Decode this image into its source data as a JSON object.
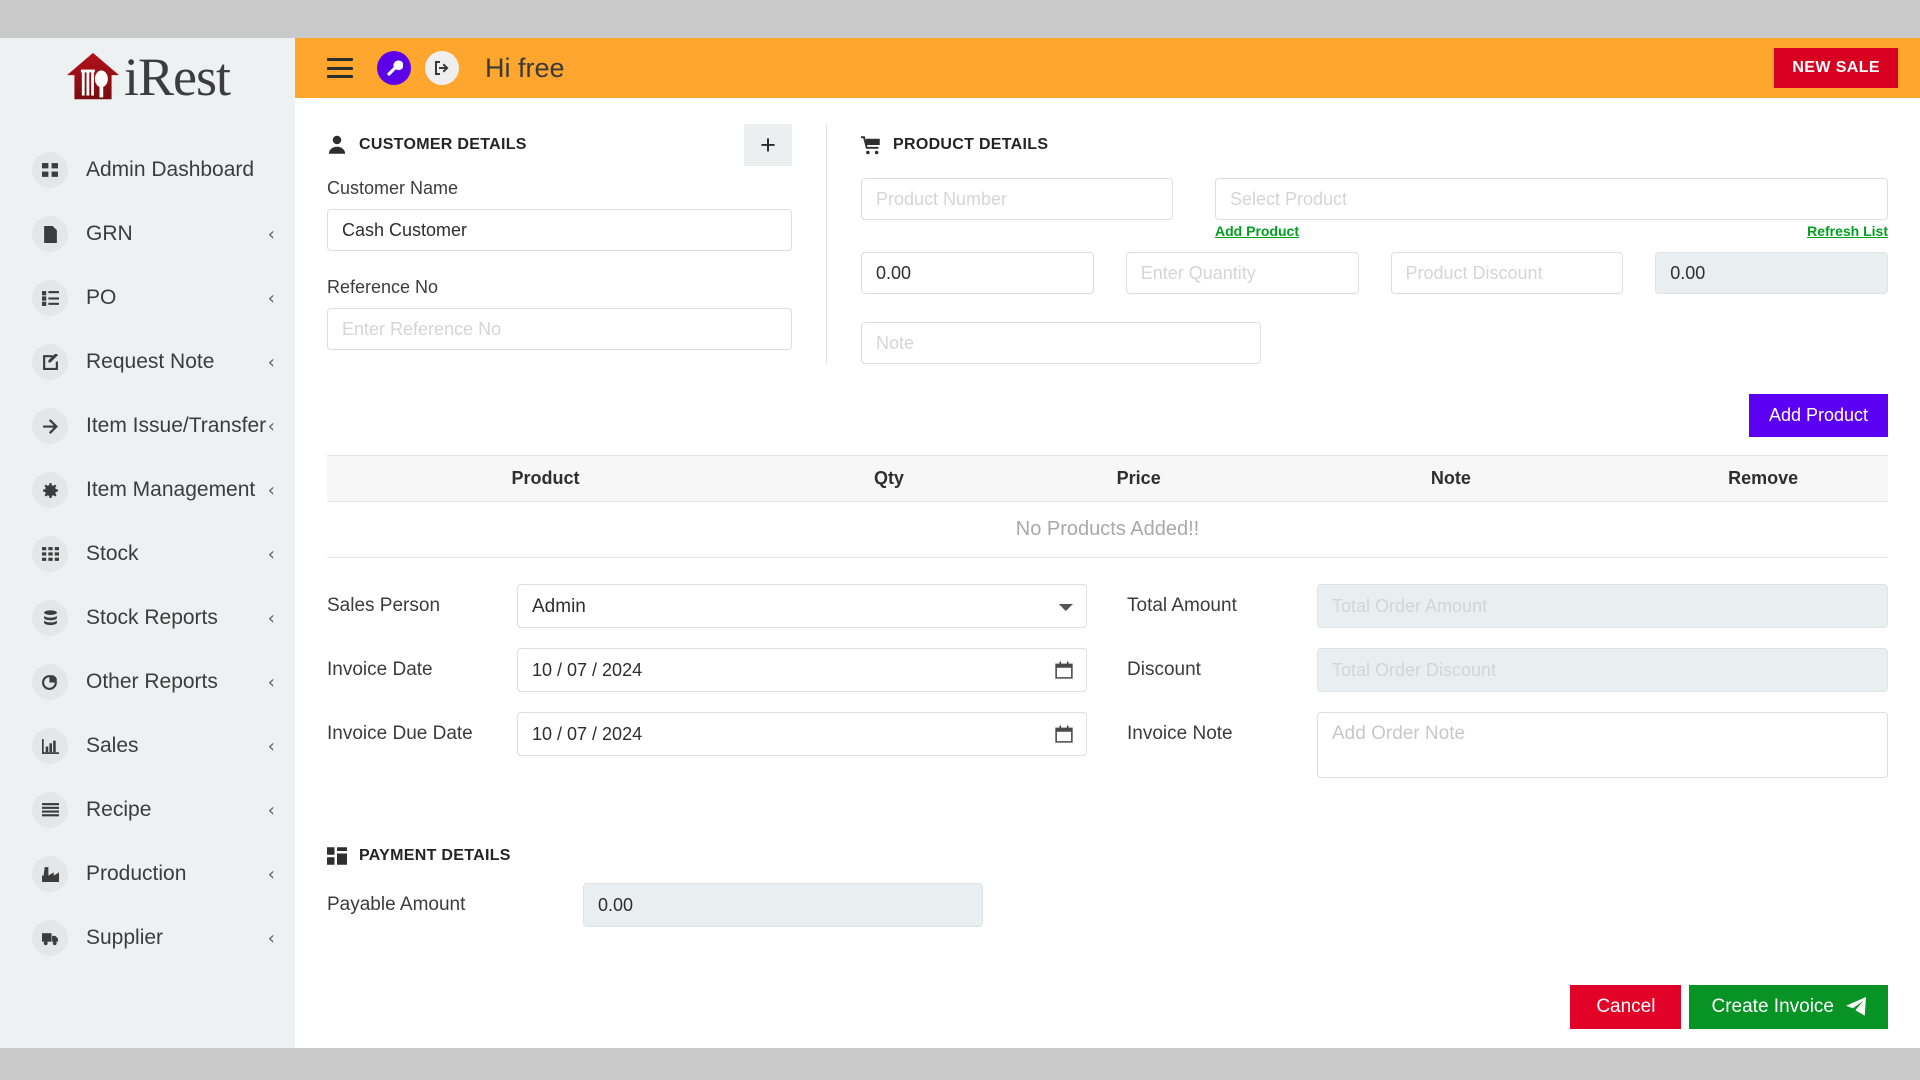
{
  "brand": {
    "name": "iRest",
    "mark": "house-fork-spoon-logo"
  },
  "sidebar": {
    "items": [
      {
        "label": "Admin Dashboard",
        "icon": "grid-icon",
        "chevron": ""
      },
      {
        "label": "GRN",
        "icon": "file-icon",
        "chevron": "‹"
      },
      {
        "label": "PO",
        "icon": "list-icon",
        "chevron": "‹"
      },
      {
        "label": "Request Note",
        "icon": "edit-note-icon",
        "chevron": "‹"
      },
      {
        "label": "Item Issue/Transfer",
        "icon": "arrow-right-icon",
        "chevron": "‹"
      },
      {
        "label": "Item Management",
        "icon": "gear-icon",
        "chevron": "‹"
      },
      {
        "label": "Stock",
        "icon": "th-grid-icon",
        "chevron": "‹"
      },
      {
        "label": "Stock Reports",
        "icon": "database-icon",
        "chevron": "‹"
      },
      {
        "label": "Other Reports",
        "icon": "pie-chart-icon",
        "chevron": "‹"
      },
      {
        "label": "Sales",
        "icon": "bar-chart-icon",
        "chevron": "‹"
      },
      {
        "label": "Recipe",
        "icon": "list-lines-icon",
        "chevron": "‹"
      },
      {
        "label": "Production",
        "icon": "factory-icon",
        "chevron": "‹"
      },
      {
        "label": "Supplier",
        "icon": "truck-icon",
        "chevron": "‹"
      }
    ]
  },
  "topbar": {
    "menu_icon": "hamburger-icon",
    "settings_icon": "wrench-icon",
    "logout_icon": "logout-icon",
    "greeting": "Hi free",
    "new_sale_label": "NEW SALE",
    "accent_orange": "#ffa62e",
    "new_sale_color": "#d80020",
    "settings_color": "#5b00e8"
  },
  "customer": {
    "section_title": "CUSTOMER DETAILS",
    "section_icon": "user-icon",
    "add_button_label": "+",
    "name_label": "Customer Name",
    "name_value": "Cash Customer",
    "reference_label": "Reference No",
    "reference_placeholder": "Enter Reference No",
    "reference_value": ""
  },
  "product": {
    "section_title": "PRODUCT DETAILS",
    "section_icon": "cart-icon",
    "product_number_placeholder": "Product Number",
    "product_number_value": "",
    "select_product_placeholder": "Select Product",
    "select_product_value": "",
    "add_product_link": "Add Product",
    "refresh_list_link": "Refresh List",
    "price_value": "0.00",
    "quantity_placeholder": "Enter Quantity",
    "quantity_value": "",
    "discount_placeholder": "Product Discount",
    "discount_value": "",
    "total_value": "0.00",
    "note_placeholder": "Note",
    "note_value": "",
    "add_product_button": "Add Product",
    "link_color": "#00a01e",
    "add_button_color": "#5b00f2"
  },
  "table": {
    "headers": [
      "Product",
      "Qty",
      "Price",
      "Note",
      "Remove"
    ],
    "empty_message": "No Products Added!!",
    "rows": []
  },
  "invoice": {
    "sales_person_label": "Sales Person",
    "sales_person_value": "Admin",
    "sales_person_options": [
      "Admin"
    ],
    "invoice_date_label": "Invoice Date",
    "invoice_date_value": "10 / 07 / 2024",
    "invoice_due_date_label": "Invoice Due Date",
    "invoice_due_date_value": "10 / 07 / 2024",
    "total_amount_label": "Total Amount",
    "total_amount_placeholder": "Total Order Amount",
    "total_amount_value": "",
    "discount_label": "Discount",
    "discount_placeholder": "Total Order Discount",
    "discount_value": "",
    "invoice_note_label": "Invoice Note",
    "invoice_note_placeholder": "Add Order Note",
    "invoice_note_value": ""
  },
  "payment": {
    "section_title": "PAYMENT DETAILS",
    "section_icon": "calculator-icon",
    "payable_label": "Payable Amount",
    "payable_value": "0.00"
  },
  "actions": {
    "cancel_label": "Cancel",
    "create_label": "Create Invoice",
    "create_icon": "paper-plane-icon",
    "cancel_color": "#e30227",
    "create_color": "#089325"
  }
}
